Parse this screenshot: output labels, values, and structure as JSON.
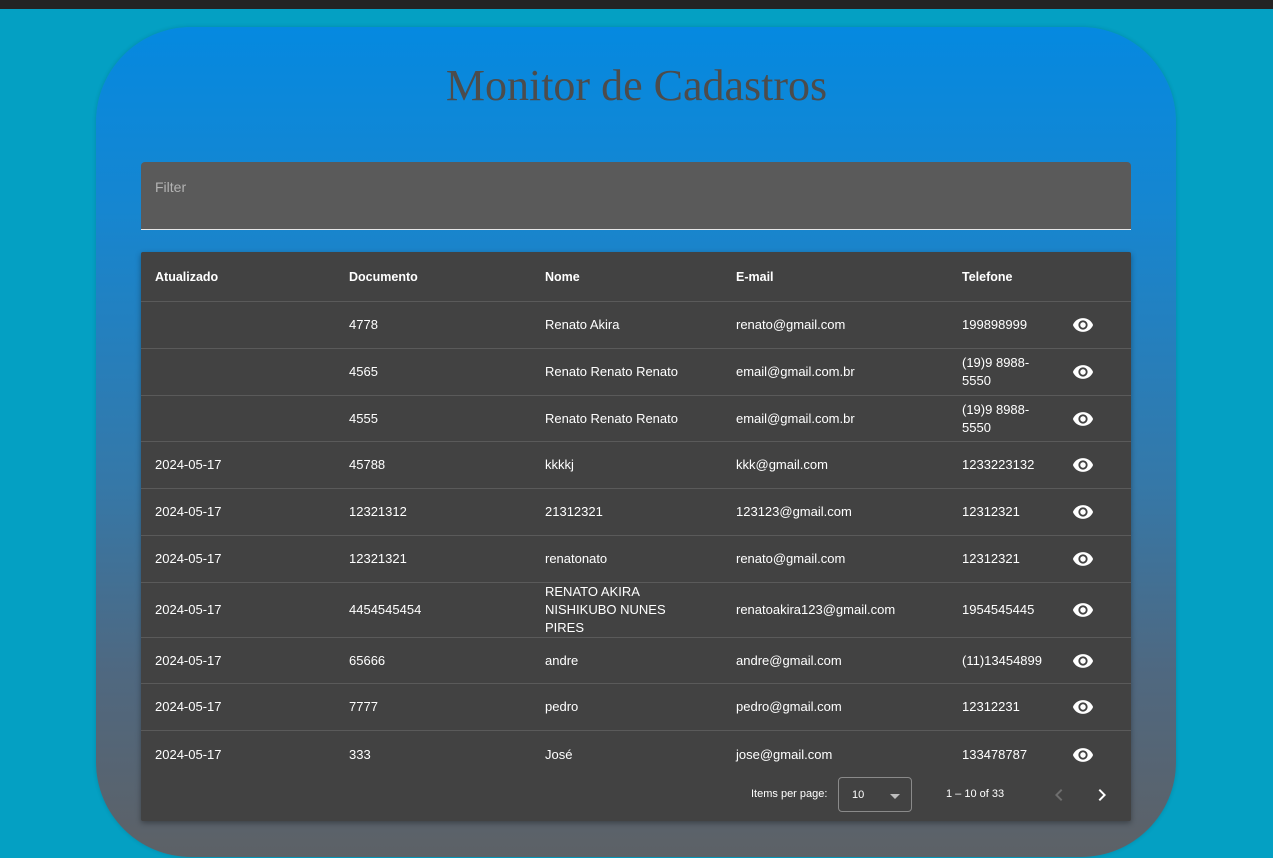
{
  "page": {
    "title": "Monitor de Cadastros"
  },
  "filter": {
    "label": "Filter",
    "value": ""
  },
  "table": {
    "columns": [
      "Atualizado",
      "Documento",
      "Nome",
      "E-mail",
      "Telefone"
    ],
    "rows": [
      {
        "atualizado": "",
        "documento": "4778",
        "nome": "Renato Akira",
        "email": "renato@gmail.com",
        "telefone": "199898999"
      },
      {
        "atualizado": "",
        "documento": "4565",
        "nome": "Renato Renato Renato",
        "email": "email@gmail.com.br",
        "telefone": "(19)9 8988-5550"
      },
      {
        "atualizado": "",
        "documento": "4555",
        "nome": "Renato Renato Renato",
        "email": "email@gmail.com.br",
        "telefone": "(19)9 8988-5550"
      },
      {
        "atualizado": "2024-05-17",
        "documento": "45788",
        "nome": "kkkkj",
        "email": "kkk@gmail.com",
        "telefone": "1233223132"
      },
      {
        "atualizado": "2024-05-17",
        "documento": "12321312",
        "nome": "21312321",
        "email": "123123@gmail.com",
        "telefone": "12312321"
      },
      {
        "atualizado": "2024-05-17",
        "documento": "12321321",
        "nome": "renatonato",
        "email": "renato@gmail.com",
        "telefone": "12312321"
      },
      {
        "atualizado": "2024-05-17",
        "documento": "4454545454",
        "nome": "RENATO AKIRA NISHIKUBO NUNES PIRES",
        "email": "renatoakira123@gmail.com",
        "telefone": "1954545445"
      },
      {
        "atualizado": "2024-05-17",
        "documento": "65666",
        "nome": "andre",
        "email": "andre@gmail.com",
        "telefone": "(11)13454899"
      },
      {
        "atualizado": "2024-05-17",
        "documento": "7777",
        "nome": "pedro",
        "email": "pedro@gmail.com",
        "telefone": "12312231"
      },
      {
        "atualizado": "2024-05-17",
        "documento": "333",
        "nome": "José",
        "email": "jose@gmail.com",
        "telefone": "133478787"
      }
    ],
    "row_action_icon": "eye-icon"
  },
  "paginator": {
    "items_per_page_label": "Items per page:",
    "page_size": "10",
    "range_label": "1 – 10 of 33",
    "prev_icon": "chevron-left-icon",
    "next_icon": "chevron-right-icon"
  },
  "colors": {
    "background": "#04a0c3",
    "panel_top": "#0589e0",
    "panel_bottom": "#5d6166",
    "table_background": "#424242",
    "filter_background": "#5a5a5a",
    "title_color": "#4c4c4c"
  }
}
